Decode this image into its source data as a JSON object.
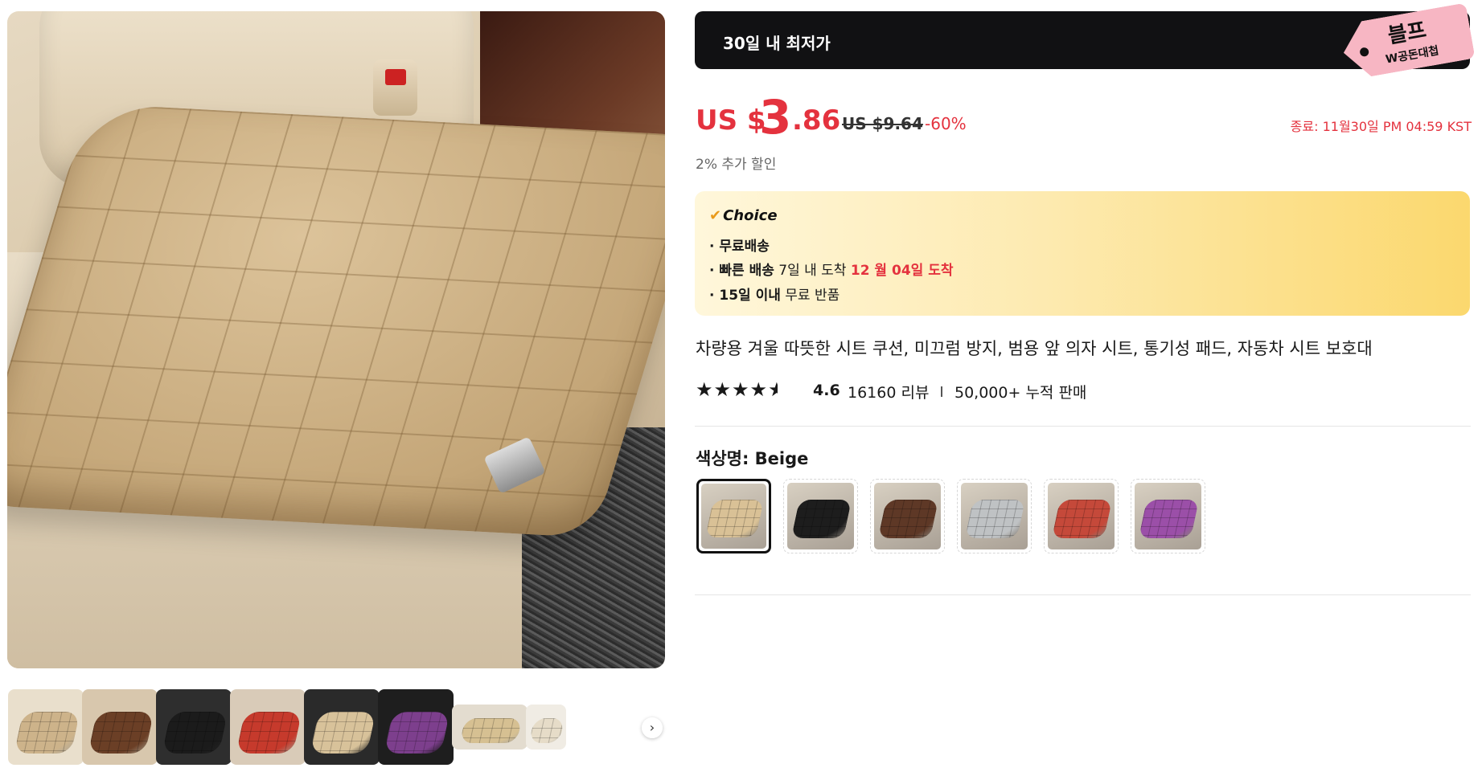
{
  "gallery": {
    "thumbnails": [
      {
        "name": "beige",
        "seat": "#cdb38a",
        "bg": "#e9dfcc"
      },
      {
        "name": "brown",
        "seat": "#6b3f26",
        "bg": "#d8c7ad"
      },
      {
        "name": "black",
        "seat": "#1b1b1b",
        "bg": "#2e2e2e"
      },
      {
        "name": "red",
        "seat": "#c63a2c",
        "bg": "#d9cbb8"
      },
      {
        "name": "beige-front-rear",
        "seat": "#d8c29a",
        "bg": "#2a2a2a"
      },
      {
        "name": "multicolor",
        "seat": "#7d3f8d",
        "bg": "#1e1e1e"
      },
      {
        "name": "beige-wide",
        "seat": "#d6c092",
        "bg": "#e3dccf"
      },
      {
        "name": "partial",
        "seat": "#e6dcc8",
        "bg": "#f0ece4"
      }
    ],
    "next_arrow": "›"
  },
  "promo": {
    "label": "30일 내 최저가",
    "tag_title": "블프",
    "tag_sub": "W공돈대첩"
  },
  "price": {
    "currency": "US $",
    "integer": "3",
    "decimal": ".86",
    "original": "US $9.64",
    "discount": "-60%",
    "ends": "종료: 11월30일 PM 04:59 KST",
    "extra_discount": "2% 추가 할인",
    "accent_color": "#e4323e"
  },
  "choice": {
    "check": "✔",
    "title": "Choice",
    "free_shipping": "· 무료배송",
    "fast_label": "· 빠른 배송",
    "fast_days": " 7일 내 도착 ",
    "fast_date": "12 월 04일 도착",
    "return_label": "· 15일 이내",
    "return_text": "  무료 반품"
  },
  "product": {
    "title": "차량용 겨울 따뜻한 시트 쿠션, 미끄럼 방지, 범용 앞 의자 시트, 통기성 패드, 자동차 시트 보호대",
    "stars": "★★★★",
    "star_half": "★",
    "rating": "4.6",
    "reviews": "16160 리뷰",
    "sold": "50,000+ 누적 판매"
  },
  "color": {
    "label": "색상명: Beige",
    "options": [
      {
        "name": "Beige",
        "seat": "#d9c196",
        "selected": true
      },
      {
        "name": "Black",
        "seat": "#1d1d1d",
        "selected": false
      },
      {
        "name": "Brown",
        "seat": "#5e3826",
        "selected": false
      },
      {
        "name": "Gray",
        "seat": "#bfc2c4",
        "selected": false
      },
      {
        "name": "Red",
        "seat": "#c5493a",
        "selected": false
      },
      {
        "name": "Purple",
        "seat": "#9b4fa8",
        "selected": false
      }
    ]
  }
}
